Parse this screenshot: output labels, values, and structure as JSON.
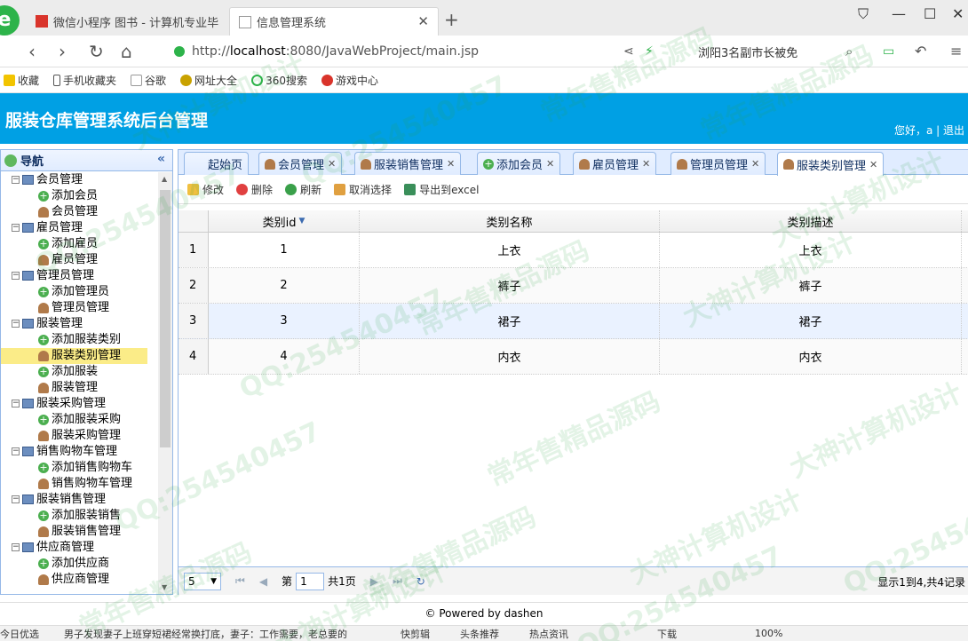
{
  "browser": {
    "tabs": [
      {
        "label": "微信小程序 图书 - 计算机专业毕"
      },
      {
        "label": "信息管理系统"
      }
    ],
    "url_prefix": "http://",
    "url_host": "localhost",
    "url_rest": ":8080/JavaWebProject/main.jsp",
    "news_text": "浏阳3名副市长被免",
    "bookmarks": [
      "收藏",
      "手机收藏夹",
      "谷歌",
      "网址大全",
      "360搜索",
      "游戏中心"
    ]
  },
  "app": {
    "title": "服装仓库管理系统后台管理",
    "greeting": "您好，a | 退出"
  },
  "sidebar": {
    "title": "导航",
    "tree": [
      {
        "type": "parent",
        "label": "会员管理"
      },
      {
        "type": "add",
        "label": "添加会员"
      },
      {
        "type": "manage",
        "label": "会员管理"
      },
      {
        "type": "parent",
        "label": "雇员管理"
      },
      {
        "type": "add",
        "label": "添加雇员"
      },
      {
        "type": "manage",
        "label": "雇员管理"
      },
      {
        "type": "parent",
        "label": "管理员管理"
      },
      {
        "type": "add",
        "label": "添加管理员"
      },
      {
        "type": "manage",
        "label": "管理员管理"
      },
      {
        "type": "parent",
        "label": "服装管理"
      },
      {
        "type": "add",
        "label": "添加服装类别"
      },
      {
        "type": "manage",
        "label": "服装类别管理",
        "selected": true
      },
      {
        "type": "add",
        "label": "添加服装"
      },
      {
        "type": "manage",
        "label": "服装管理"
      },
      {
        "type": "parent",
        "label": "服装采购管理"
      },
      {
        "type": "add",
        "label": "添加服装采购"
      },
      {
        "type": "manage",
        "label": "服装采购管理"
      },
      {
        "type": "parent",
        "label": "销售购物车管理"
      },
      {
        "type": "add",
        "label": "添加销售购物车"
      },
      {
        "type": "manage",
        "label": "销售购物车管理"
      },
      {
        "type": "parent",
        "label": "服装销售管理"
      },
      {
        "type": "add",
        "label": "添加服装销售"
      },
      {
        "type": "manage",
        "label": "服装销售管理"
      },
      {
        "type": "parent",
        "label": "供应商管理"
      },
      {
        "type": "add",
        "label": "添加供应商"
      },
      {
        "type": "manage",
        "label": "供应商管理"
      }
    ]
  },
  "tabs": [
    {
      "label": "起始页",
      "closable": false
    },
    {
      "label": "会员管理",
      "closable": true
    },
    {
      "label": "服装销售管理",
      "closable": true
    },
    {
      "label": "添加会员",
      "closable": true
    },
    {
      "label": "雇员管理",
      "closable": true
    },
    {
      "label": "管理员管理",
      "closable": true
    },
    {
      "label": "服装类别管理",
      "closable": true,
      "active": true
    }
  ],
  "toolbar": {
    "edit": "修改",
    "delete": "删除",
    "refresh": "刷新",
    "unselect": "取消选择",
    "export": "导出到excel"
  },
  "grid": {
    "columns": [
      "类别id",
      "类别名称",
      "类别描述"
    ],
    "rows": [
      {
        "num": "1",
        "id": "1",
        "name": "上衣",
        "desc": "上衣"
      },
      {
        "num": "2",
        "id": "2",
        "name": "裤子",
        "desc": "裤子"
      },
      {
        "num": "3",
        "id": "3",
        "name": "裙子",
        "desc": "裙子"
      },
      {
        "num": "4",
        "id": "4",
        "name": "内衣",
        "desc": "内衣"
      }
    ]
  },
  "pager": {
    "page_size": "5",
    "page_label": "第",
    "page_value": "1",
    "total_pages": "共1页",
    "info": "显示1到4,共4记录"
  },
  "footer": "© Powered by dashen",
  "statusbar": {
    "left": "今日优选",
    "headline": "男子发现妻子上班穿短裙经常换打底，妻子：工作需要，老总要的",
    "items": [
      "快剪辑",
      "头条推荐",
      "热点资讯",
      "下载",
      "100%"
    ]
  },
  "watermarks": [
    "QQ:254540457",
    "常年售精品源码",
    "大神计算机设计"
  ]
}
